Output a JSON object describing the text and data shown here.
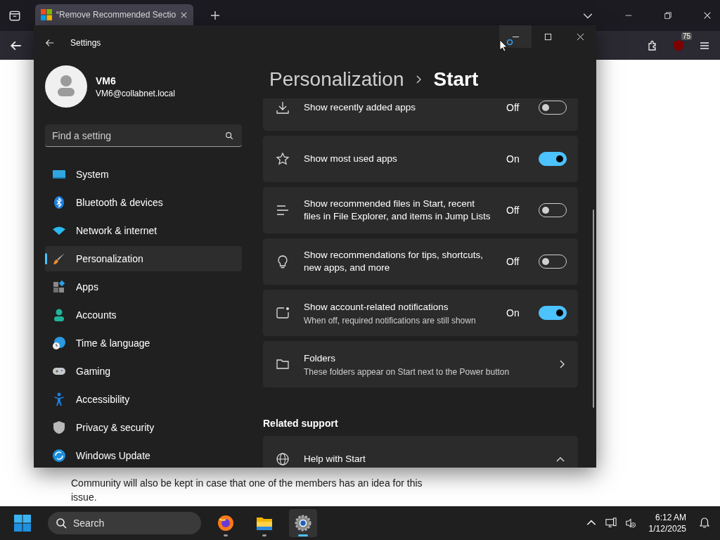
{
  "browser": {
    "tab_title": "“Remove Recommended Sectio",
    "extension_badge": "75"
  },
  "page": {
    "paragraph_lines": [
      "Community will also be kept in case that one of the members has an idea for this",
      "issue."
    ]
  },
  "settings": {
    "title": "Settings",
    "user": {
      "name": "VM6",
      "email": "VM6@collabnet.local"
    },
    "search": {
      "placeholder": "Find a setting"
    },
    "nav": [
      {
        "label": "System",
        "selected": false
      },
      {
        "label": "Bluetooth & devices",
        "selected": false
      },
      {
        "label": "Network & internet",
        "selected": false
      },
      {
        "label": "Personalization",
        "selected": true
      },
      {
        "label": "Apps",
        "selected": false
      },
      {
        "label": "Accounts",
        "selected": false
      },
      {
        "label": "Time & language",
        "selected": false
      },
      {
        "label": "Gaming",
        "selected": false
      },
      {
        "label": "Accessibility",
        "selected": false
      },
      {
        "label": "Privacy & security",
        "selected": false
      },
      {
        "label": "Windows Update",
        "selected": false
      }
    ],
    "breadcrumb": {
      "parent": "Personalization",
      "current": "Start"
    },
    "options": [
      {
        "kind": "toggle",
        "label": "Show recently added apps",
        "state_text": "Off",
        "on": false
      },
      {
        "kind": "toggle",
        "label": "Show most used apps",
        "state_text": "On",
        "on": true
      },
      {
        "kind": "toggle",
        "label": "Show recommended files in Start, recent files in File Explorer, and items in Jump Lists",
        "state_text": "Off",
        "on": false
      },
      {
        "kind": "toggle",
        "label": "Show recommendations for tips, shortcuts, new apps, and more",
        "state_text": "Off",
        "on": false
      },
      {
        "kind": "toggle",
        "label": "Show account-related notifications",
        "description": "When off, required notifications are still shown",
        "state_text": "On",
        "on": true
      },
      {
        "kind": "link",
        "label": "Folders",
        "description": "These folders appear on Start next to the Power button"
      }
    ],
    "related_heading": "Related support",
    "help": {
      "label": "Help with Start",
      "expanded": true
    }
  },
  "taskbar": {
    "search_placeholder": "Search",
    "apps": [
      {
        "selected": false
      },
      {
        "selected": false
      },
      {
        "selected": true
      }
    ],
    "time": "6:12 AM",
    "date": "1/12/2025"
  }
}
